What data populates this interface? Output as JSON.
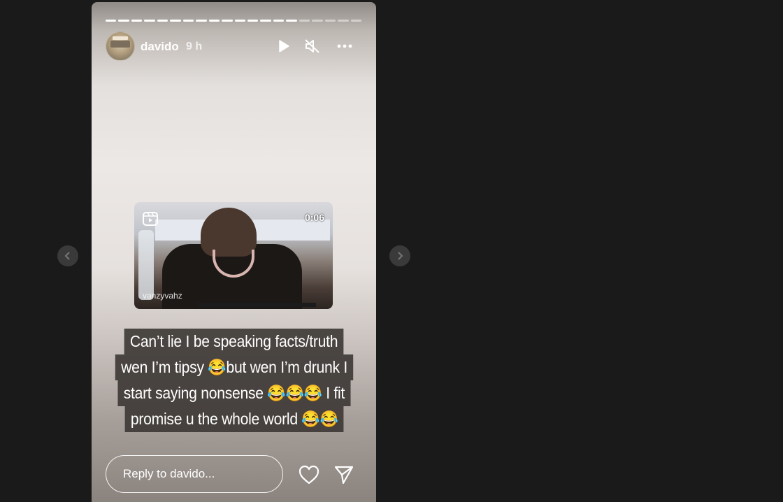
{
  "story": {
    "username": "davido",
    "time": "9 h",
    "progress": {
      "segments": 20,
      "completed": 15
    },
    "media": {
      "duration": "0:06",
      "handle": "vanzyvahz"
    },
    "caption": [
      "Can’t lie I be speaking facts/truth",
      "wen I’m tipsy 😂but wen I’m drunk I",
      "start saying nonsense 😂😂😂 I fit",
      "promise u the whole world 😂😂"
    ]
  },
  "reply": {
    "placeholder": "Reply to davido..."
  },
  "icons": {
    "play": "play-icon",
    "mute": "muted-speaker-icon",
    "more": "more-horizontal-icon",
    "like": "heart-icon",
    "share": "send-icon",
    "prev": "chevron-left-icon",
    "next": "chevron-right-icon",
    "reel": "reel-icon"
  }
}
